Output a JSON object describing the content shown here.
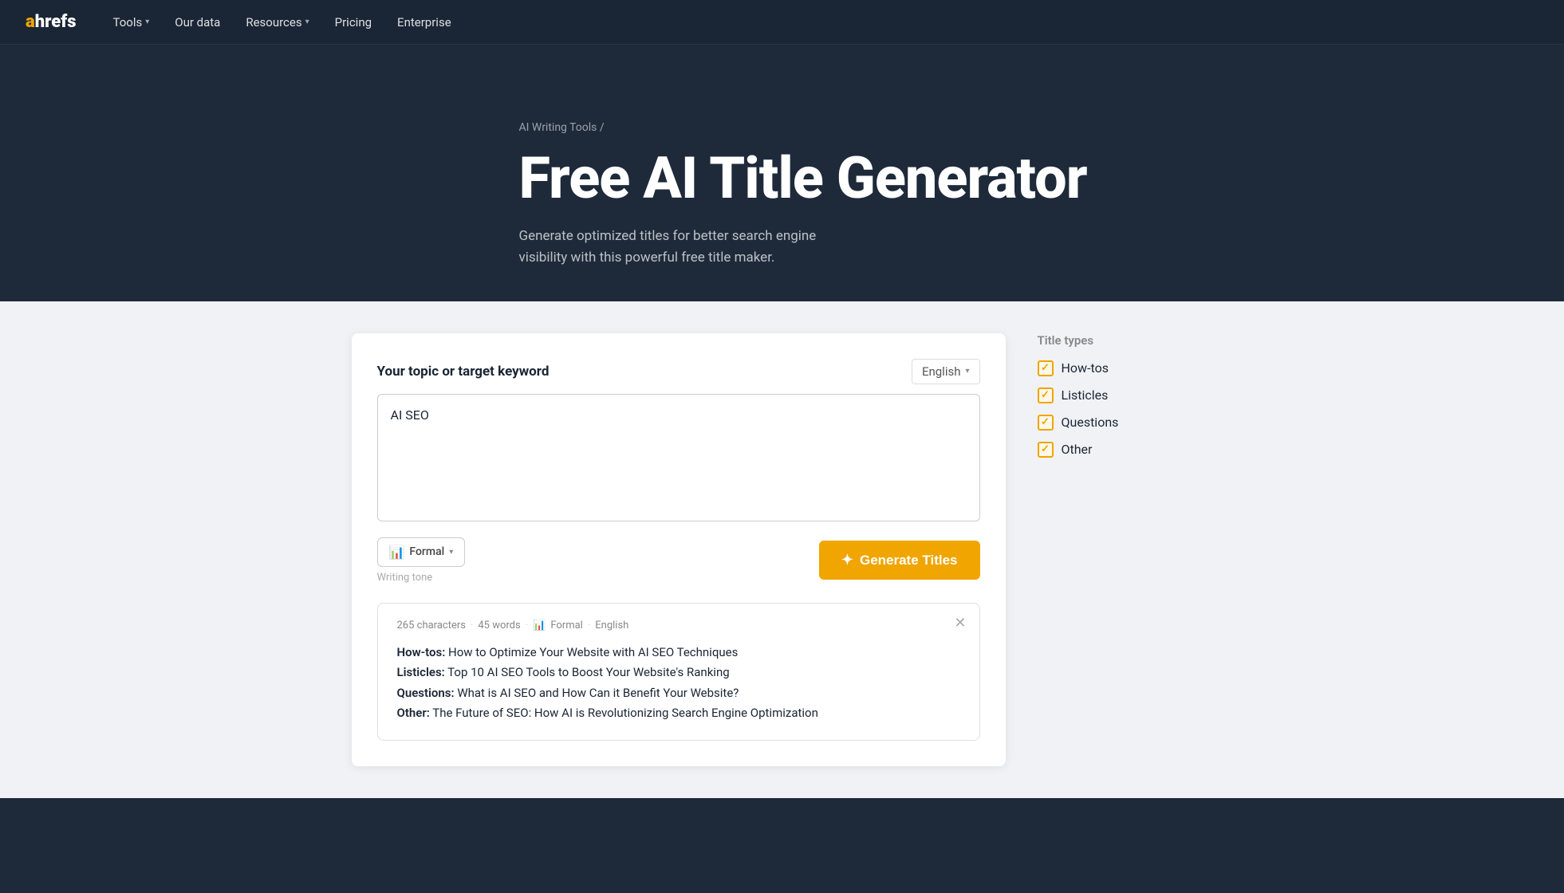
{
  "nav": {
    "logo_a": "a",
    "logo_hrefs": "hrefs",
    "links": [
      {
        "label": "Tools",
        "has_dropdown": true
      },
      {
        "label": "Our data",
        "has_dropdown": false
      },
      {
        "label": "Resources",
        "has_dropdown": true
      },
      {
        "label": "Pricing",
        "has_dropdown": false
      },
      {
        "label": "Enterprise",
        "has_dropdown": false
      }
    ]
  },
  "hero": {
    "breadcrumb_link": "AI Writing Tools",
    "breadcrumb_separator": "/",
    "title": "Free AI Title Generator",
    "subtitle": "Generate optimized titles for better search engine visibility with this powerful free title maker."
  },
  "tool": {
    "keyword_label": "Your topic or target keyword",
    "language": "English",
    "textarea_value": "AI SEO",
    "tone_label": "Formal",
    "tone_icon": "📊",
    "writing_tone_sublabel": "Writing tone",
    "generate_button": "Generate Titles",
    "generate_icon": "✦"
  },
  "title_types": {
    "heading": "Title types",
    "items": [
      {
        "label": "How-tos",
        "checked": true
      },
      {
        "label": "Listicles",
        "checked": true
      },
      {
        "label": "Questions",
        "checked": true
      },
      {
        "label": "Other",
        "checked": true
      }
    ]
  },
  "results": {
    "meta_chars": "265 characters",
    "meta_words": "45 words",
    "meta_tone_icon": "📊",
    "meta_tone": "Formal",
    "meta_separator": "·",
    "meta_language": "English",
    "lines": [
      {
        "prefix": "How-tos:",
        "text": " How to Optimize Your Website with AI SEO Techniques"
      },
      {
        "prefix": "Listicles:",
        "text": " Top 10 AI SEO Tools to Boost Your Website's Ranking"
      },
      {
        "prefix": "Questions:",
        "text": " What is AI SEO and How Can it Benefit Your Website?"
      },
      {
        "prefix": "Other:",
        "text": " The Future of SEO: How AI is Revolutionizing Search Engine Optimization"
      }
    ]
  }
}
